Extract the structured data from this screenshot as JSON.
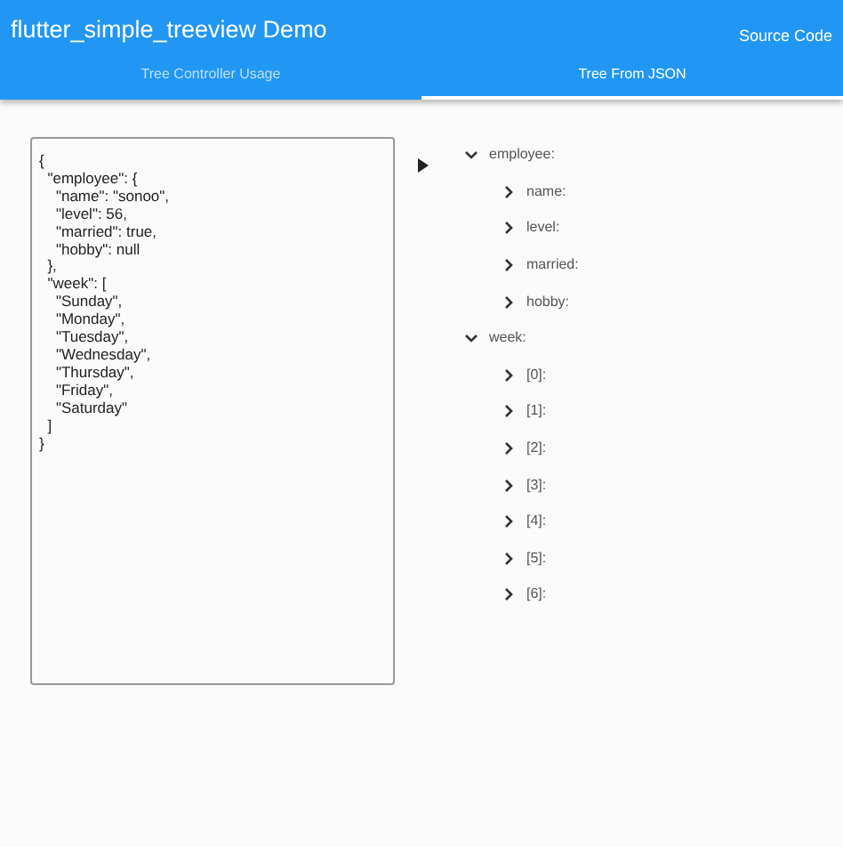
{
  "app_bar": {
    "title": "flutter_simple_treeview Demo",
    "action": "Source Code"
  },
  "tabs": [
    {
      "label": "Tree Controller Usage",
      "selected": false
    },
    {
      "label": "Tree From JSON",
      "selected": true
    }
  ],
  "json_editor": {
    "value": "{\n  \"employee\": {\n    \"name\": \"sonoo\",\n    \"level\": 56,\n    \"married\": true,\n    \"hobby\": null\n  },\n  \"week\": [\n    \"Sunday\",\n    \"Monday\",\n    \"Tuesday\",\n    \"Wednesday\",\n    \"Thursday\",\n    \"Friday\",\n    \"Saturday\"\n  ]\n}"
  },
  "tree": [
    {
      "label": "employee:",
      "expanded": true,
      "children": [
        {
          "label": "name:",
          "expanded": false
        },
        {
          "label": "level:",
          "expanded": false
        },
        {
          "label": "married:",
          "expanded": false
        },
        {
          "label": "hobby:",
          "expanded": false
        }
      ]
    },
    {
      "label": "week:",
      "expanded": true,
      "children": [
        {
          "label": "[0]:",
          "expanded": false
        },
        {
          "label": "[1]:",
          "expanded": false
        },
        {
          "label": "[2]:",
          "expanded": false
        },
        {
          "label": "[3]:",
          "expanded": false
        },
        {
          "label": "[4]:",
          "expanded": false
        },
        {
          "label": "[5]:",
          "expanded": false
        },
        {
          "label": "[6]:",
          "expanded": false
        }
      ]
    }
  ]
}
